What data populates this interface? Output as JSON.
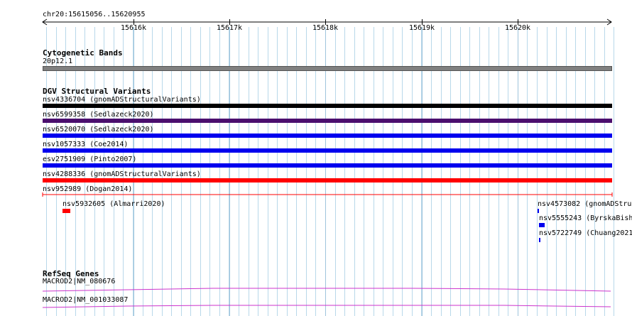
{
  "location": "chr20:15615056..15620955",
  "ruler": {
    "ticks": [
      "15616k",
      "15617k",
      "15618k",
      "15619k",
      "15620k"
    ]
  },
  "tracks": {
    "cytoband": {
      "title": "Cytogenetic Bands",
      "band": "20p12.1",
      "color": "#808080"
    },
    "dgv": {
      "title": "DGV Structural Variants",
      "variants": [
        {
          "label": "nsv4336704 (gnomADStructuralVariants)",
          "color": "#000000"
        },
        {
          "label": "nsv6599358 (Sedlazeck2020)",
          "color": "#4b0f6e"
        },
        {
          "label": "nsv6520070 (Sedlazeck2020)",
          "color": "#0000ee"
        },
        {
          "label": "nsv1057333 (Coe2014)",
          "color": "#0000ee"
        },
        {
          "label": "esv2751909 (Pinto2007)",
          "color": "#0000ee"
        },
        {
          "label": "nsv4288336 (gnomADStructuralVariants)",
          "color": "#ff0000"
        },
        {
          "label": "nsv952989 (Dogan2014)",
          "color": "#ff0000"
        }
      ],
      "small_variants": [
        {
          "label": "nsv5932605 (Almarri2020)",
          "color": "#ff0000"
        },
        {
          "label": "nsv4573082 (gnomADStruc",
          "color": "#0000ee"
        },
        {
          "label": "nsv5555243 (ByrskaBish",
          "color": "#0000ee"
        },
        {
          "label": "nsv5722749 (Chuang2021",
          "color": "#0000ee"
        }
      ]
    },
    "refseq": {
      "title": "RefSeq Genes",
      "genes": [
        {
          "label": "MACROD2|NM_080676",
          "color": "#cc33cc"
        },
        {
          "label": "MACROD2|NM_001033087",
          "color": "#cc33cc"
        }
      ]
    }
  },
  "colors": {
    "grid": "#b8d8ea",
    "ruler": "#000000"
  }
}
